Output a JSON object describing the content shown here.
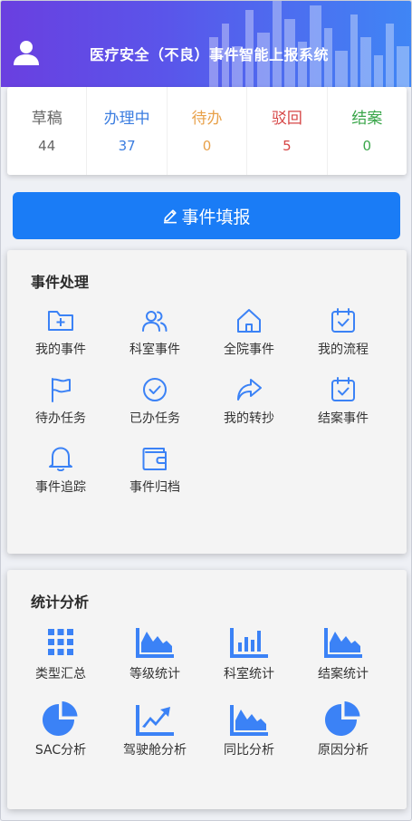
{
  "header": {
    "title": "医疗安全（不良）事件智能上报系统"
  },
  "stats": [
    {
      "label": "草稿",
      "value": "44",
      "color": "#666666"
    },
    {
      "label": "办理中",
      "value": "37",
      "color": "#3b7de0"
    },
    {
      "label": "待办",
      "value": "0",
      "color": "#e8a14a"
    },
    {
      "label": "驳回",
      "value": "5",
      "color": "#d64545"
    },
    {
      "label": "结案",
      "value": "0",
      "color": "#3aa64a"
    }
  ],
  "report_button": {
    "label": "事件填报",
    "icon": "pencil-icon"
  },
  "event_panel": {
    "title": "事件处理",
    "items": [
      {
        "label": "我的事件",
        "icon": "folder-add-icon"
      },
      {
        "label": "科室事件",
        "icon": "users-icon"
      },
      {
        "label": "全院事件",
        "icon": "home-icon"
      },
      {
        "label": "我的流程",
        "icon": "calendar-check-icon"
      },
      {
        "label": "待办任务",
        "icon": "flag-icon"
      },
      {
        "label": "已办任务",
        "icon": "check-circle-icon"
      },
      {
        "label": "我的转抄",
        "icon": "share-icon"
      },
      {
        "label": "结案事件",
        "icon": "calendar-check-icon"
      },
      {
        "label": "事件追踪",
        "icon": "bell-icon"
      },
      {
        "label": "事件归档",
        "icon": "wallet-icon"
      }
    ]
  },
  "stats_panel": {
    "title": "统计分析",
    "items": [
      {
        "label": "类型汇总",
        "icon": "grid-icon"
      },
      {
        "label": "等级统计",
        "icon": "area-chart-icon"
      },
      {
        "label": "科室统计",
        "icon": "bar-chart-icon"
      },
      {
        "label": "结案统计",
        "icon": "area-chart-icon"
      },
      {
        "label": "SAC分析",
        "icon": "pie-chart-icon"
      },
      {
        "label": "驾驶舱分析",
        "icon": "line-chart-icon"
      },
      {
        "label": "同比分析",
        "icon": "area-chart-icon"
      },
      {
        "label": "原因分析",
        "icon": "pie-chart-icon"
      }
    ]
  },
  "colors": {
    "accent": "#1a7cf6",
    "icon_blue": "#3b82f6"
  }
}
